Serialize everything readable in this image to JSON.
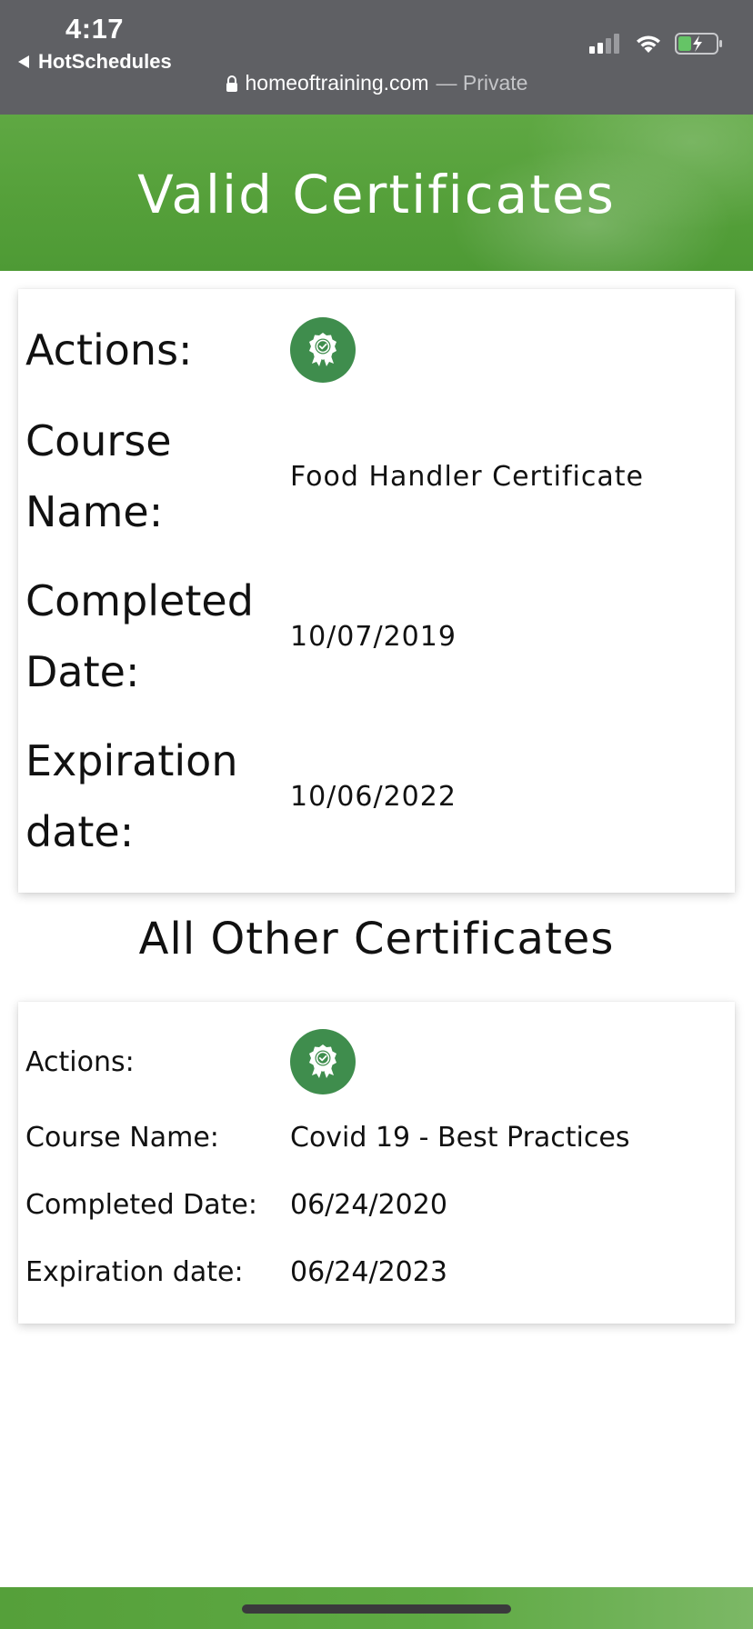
{
  "status_bar": {
    "time": "4:17",
    "back_app": "HotSchedules",
    "url": "homeoftraining.com",
    "url_suffix": "— Private"
  },
  "header": {
    "title": "Valid Certificates"
  },
  "valid_certificate": {
    "actions_label": "Actions:",
    "course_name_label_line1": "Course",
    "course_name_label_line2": "Name:",
    "course_name": "Food Handler Certificate",
    "completed_label_line1": "Completed",
    "completed_label_line2": "Date:",
    "completed_date": "10/07/2019",
    "expiration_label_line1": "Expiration",
    "expiration_label_line2": "date:",
    "expiration_date": "10/06/2022",
    "action_icon": "certificate-badge-icon"
  },
  "other_section": {
    "heading": "All Other Certificates"
  },
  "other_certificates": [
    {
      "actions_label": "Actions:",
      "course_name_label": "Course Name:",
      "course_name": "Covid 19 - Best Practices",
      "completed_label": "Completed Date:",
      "completed_date": "06/24/2020",
      "expiration_label": "Expiration date:",
      "expiration_date": "06/24/2023",
      "action_icon": "certificate-badge-icon"
    }
  ],
  "colors": {
    "brand_green": "#55a03a",
    "badge_green": "#3f8d4d",
    "status_bar_bg": "#5f6064"
  }
}
